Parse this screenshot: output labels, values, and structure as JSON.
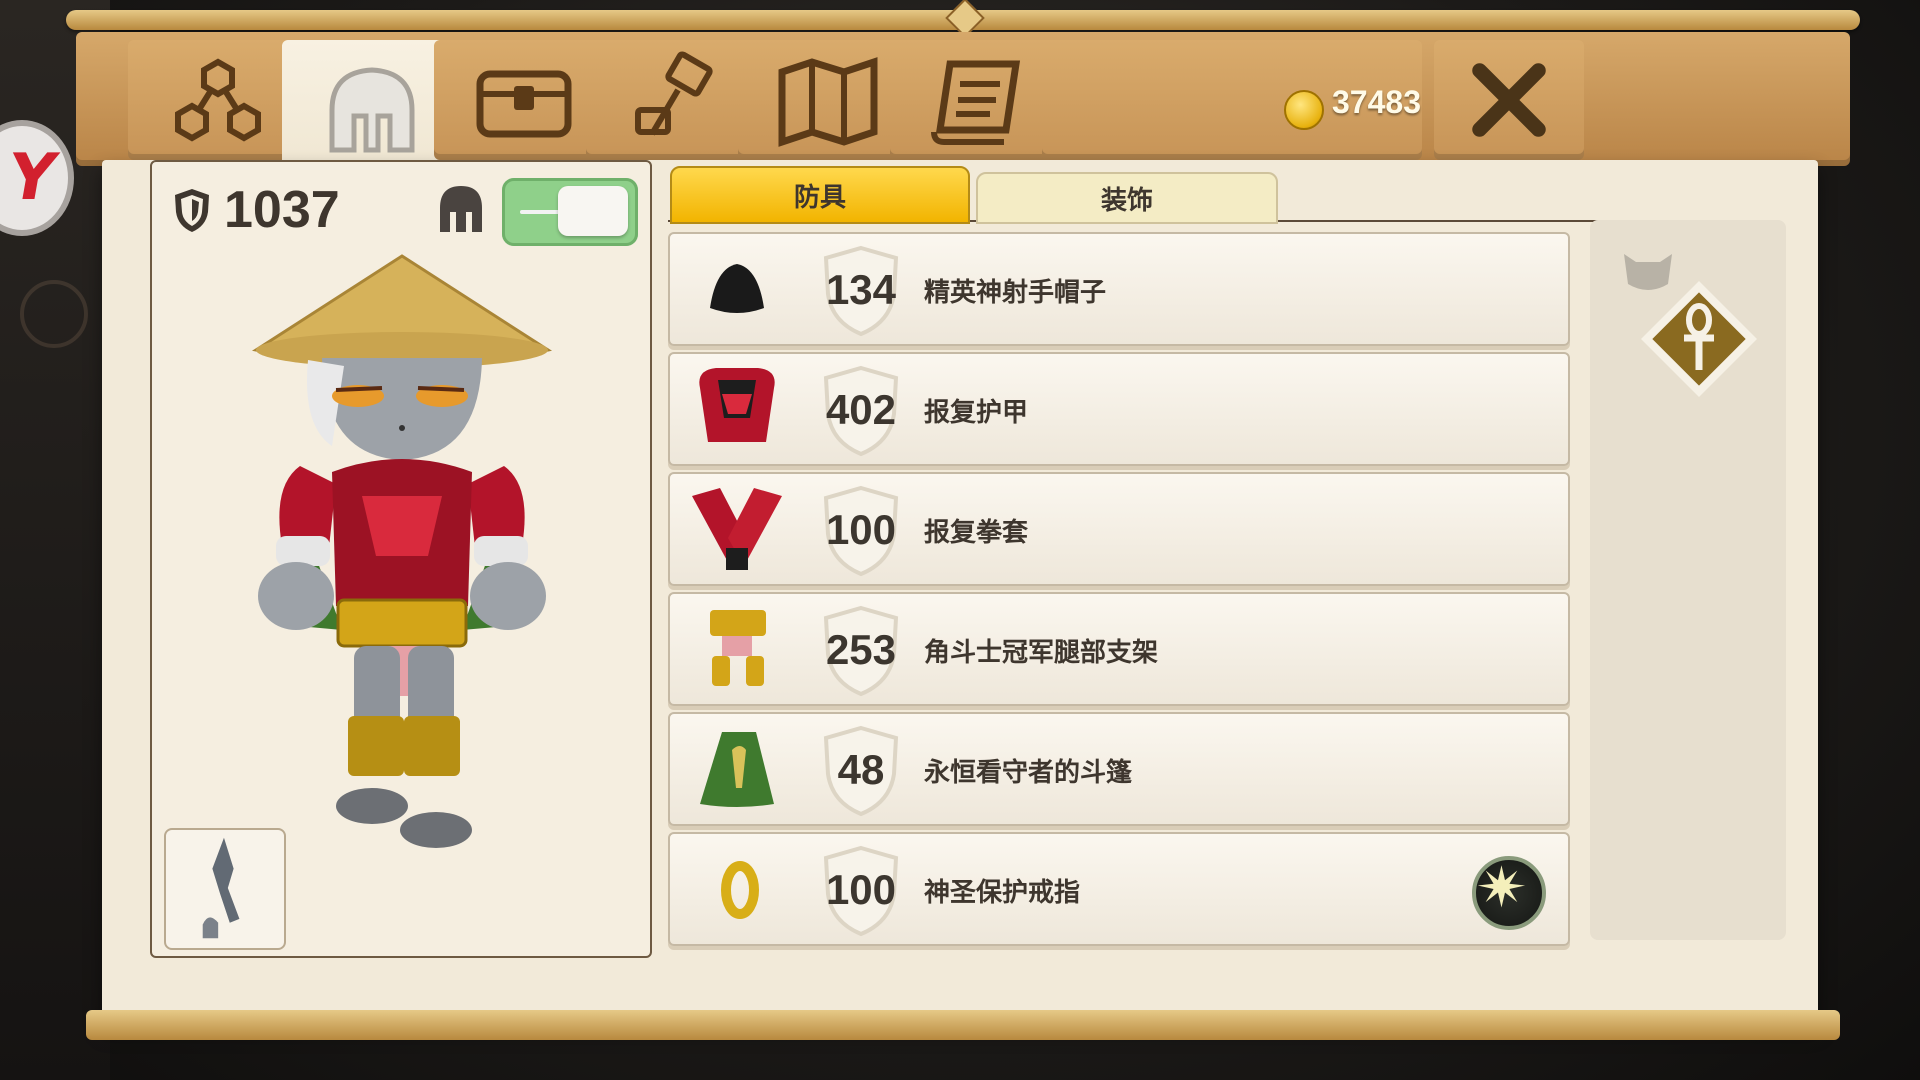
{
  "window": {
    "tabs": [
      {
        "name": "skill-tree-tab",
        "icon": "skill-tree-icon",
        "active": false
      },
      {
        "name": "equipment-tab",
        "icon": "helmet-icon",
        "active": true
      },
      {
        "name": "inventory-tab",
        "icon": "chest-icon",
        "active": false
      },
      {
        "name": "crafting-tab",
        "icon": "hammer-icon",
        "active": false
      },
      {
        "name": "map-tab",
        "icon": "map-icon",
        "active": false
      },
      {
        "name": "quests-tab",
        "icon": "scroll-icon",
        "active": false
      }
    ],
    "gold": "37483",
    "close_icon": "close-icon"
  },
  "left_badge": {
    "text": "Y"
  },
  "character": {
    "armor_total": "1037",
    "show_helmet_toggle": "on",
    "thumb_icon": "character-thumbnail"
  },
  "equipment": {
    "sub_tabs": [
      {
        "label": "防具",
        "active": true
      },
      {
        "label": "装饰",
        "active": false
      }
    ],
    "items": [
      {
        "armor": "134",
        "name": "精英神射手帽子",
        "icon": "hat-icon"
      },
      {
        "armor": "402",
        "name": "报复护甲",
        "icon": "chest-armor-icon"
      },
      {
        "armor": "100",
        "name": "报复拳套",
        "icon": "gauntlets-icon"
      },
      {
        "armor": "253",
        "name": "角斗士冠军腿部支架",
        "icon": "leg-armor-icon"
      },
      {
        "armor": "48",
        "name": "永恒看守者的斗篷",
        "icon": "cloak-icon"
      },
      {
        "armor": "100",
        "name": "神圣保护戒指",
        "icon": "ring-icon",
        "rune": "rune-socket-icon"
      }
    ],
    "side_slot": {
      "pet_icon": "pet-icon",
      "badge_icon": "ankh-icon"
    }
  },
  "colors": {
    "active_tab": "#ffd84d",
    "frame_wood": "#c79457",
    "panel": "#f2ead9",
    "toggle_on": "#8fd08a"
  }
}
